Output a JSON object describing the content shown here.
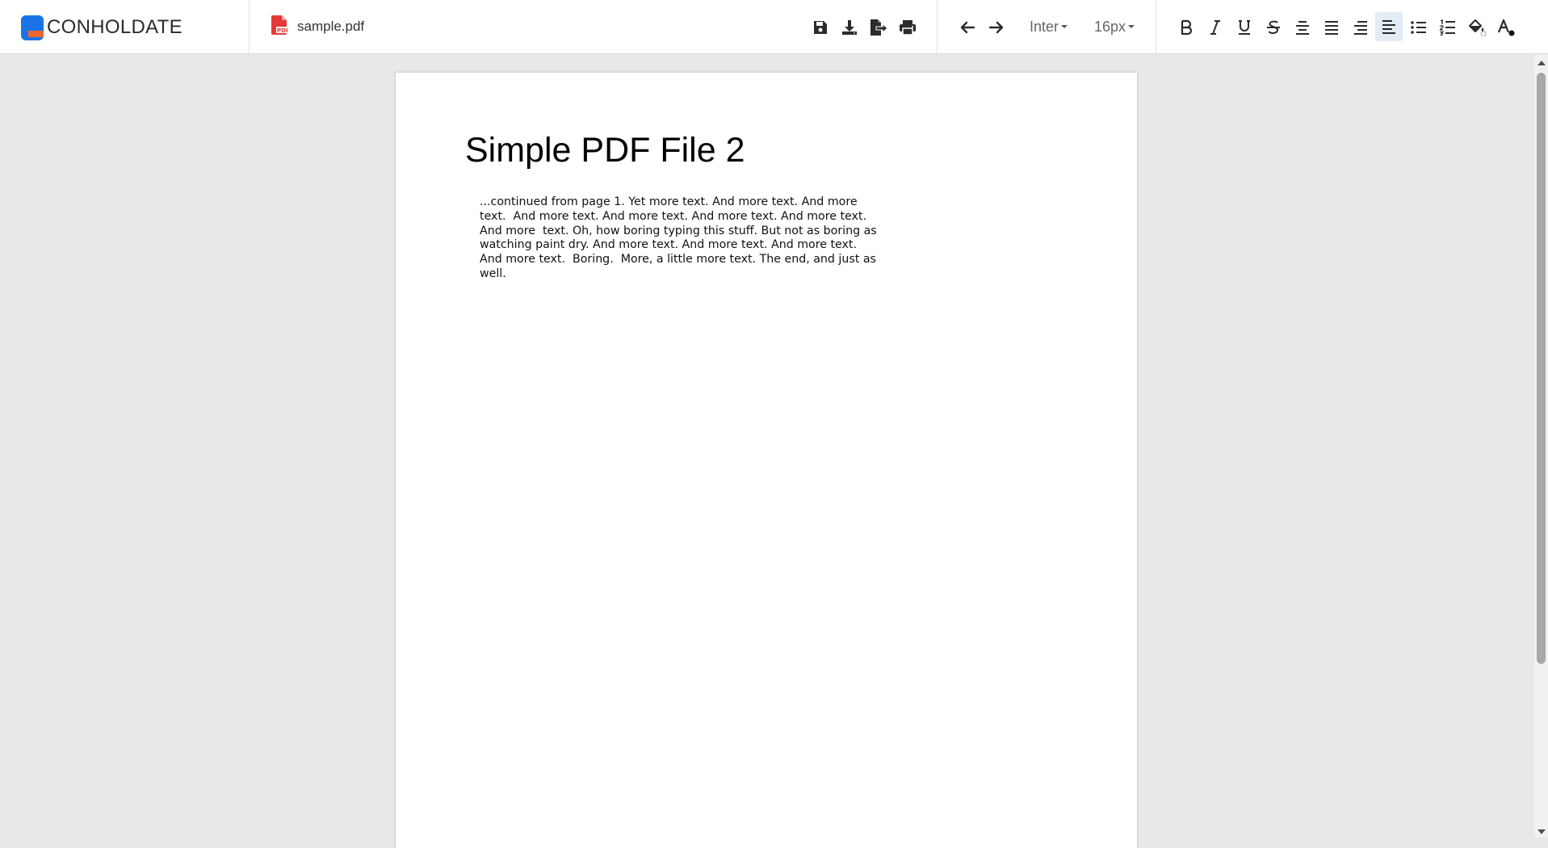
{
  "app": {
    "brand": "CONHOLDATE"
  },
  "file": {
    "name": "sample.pdf",
    "icon": "pdf-file-icon",
    "badge": "PDF"
  },
  "toolbar": {
    "font_family": "Inter",
    "font_size": "16px",
    "icons": [
      "save-icon",
      "download-icon",
      "export-icon",
      "print-icon",
      "undo-icon",
      "redo-icon",
      "bold-icon",
      "italic-icon",
      "underline-icon",
      "strikethrough-icon",
      "align-center-icon",
      "align-justify-icon",
      "align-right-icon",
      "align-left-icon",
      "bullet-list-icon",
      "numbered-list-icon",
      "highlight-color-icon",
      "text-color-icon"
    ],
    "active_item": "align-left-icon"
  },
  "document": {
    "title": "Simple PDF File 2",
    "paragraph_lines": [
      "...continued from page 1. Yet more text. And more text. And more",
      "text.  And more text. And more text. And more text. And more text.",
      "And more  text. Oh, how boring typing this stuff. But not as boring as",
      "watching paint dry. And more text. And more text. And more text.",
      "And more text.  Boring.  More, a little more text. The end, and just as",
      "well."
    ]
  },
  "colors": {
    "brand_blue": "#1b73e8",
    "brand_orange": "#f0642d",
    "pdf_red": "#e53935",
    "active_bg": "#e3ebf3"
  }
}
